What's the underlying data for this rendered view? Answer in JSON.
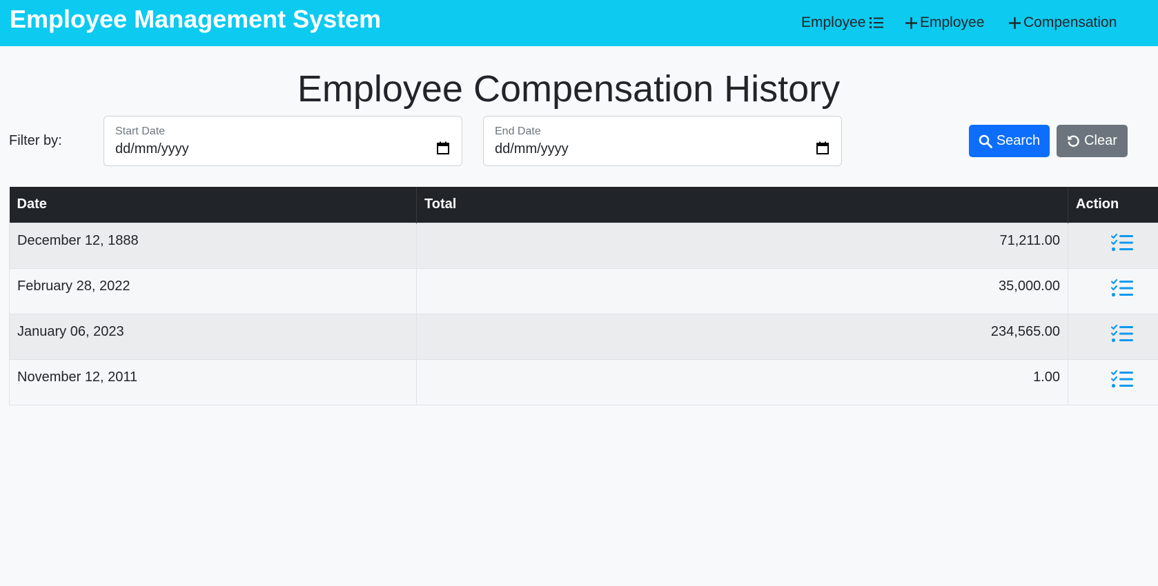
{
  "navbar": {
    "brand": "Employee Management System",
    "links": [
      {
        "label": "Employee",
        "icon": "list-icon"
      },
      {
        "label": "Employee",
        "icon": "plus-icon"
      },
      {
        "label": "Compensation",
        "icon": "plus-icon"
      }
    ],
    "background": "#0dcaf0"
  },
  "page": {
    "title": "Employee Compensation History"
  },
  "filter": {
    "label": "Filter by:",
    "start_date": {
      "label": "Start Date",
      "value": "dd/mm/yyyy",
      "icon": "calendar-icon"
    },
    "end_date": {
      "label": "End Date",
      "value": "dd/mm/yyyy",
      "icon": "calendar-icon"
    },
    "search_label": "Search",
    "clear_label": "Clear",
    "search_color": "#0d6efd",
    "clear_color": "#6c757d"
  },
  "table": {
    "headers": [
      "Date",
      "Total",
      "Action"
    ],
    "rows": [
      {
        "date": "December 12, 1888",
        "total": "71,211.00",
        "action_icon": "checklist-icon"
      },
      {
        "date": "February 28, 2022",
        "total": "35,000.00",
        "action_icon": "checklist-icon"
      },
      {
        "date": "January 06, 2023",
        "total": "234,565.00",
        "action_icon": "checklist-icon"
      },
      {
        "date": "November 12, 2011",
        "total": "1.00",
        "action_icon": "checklist-icon"
      }
    ],
    "action_color": "#0d99f0"
  }
}
